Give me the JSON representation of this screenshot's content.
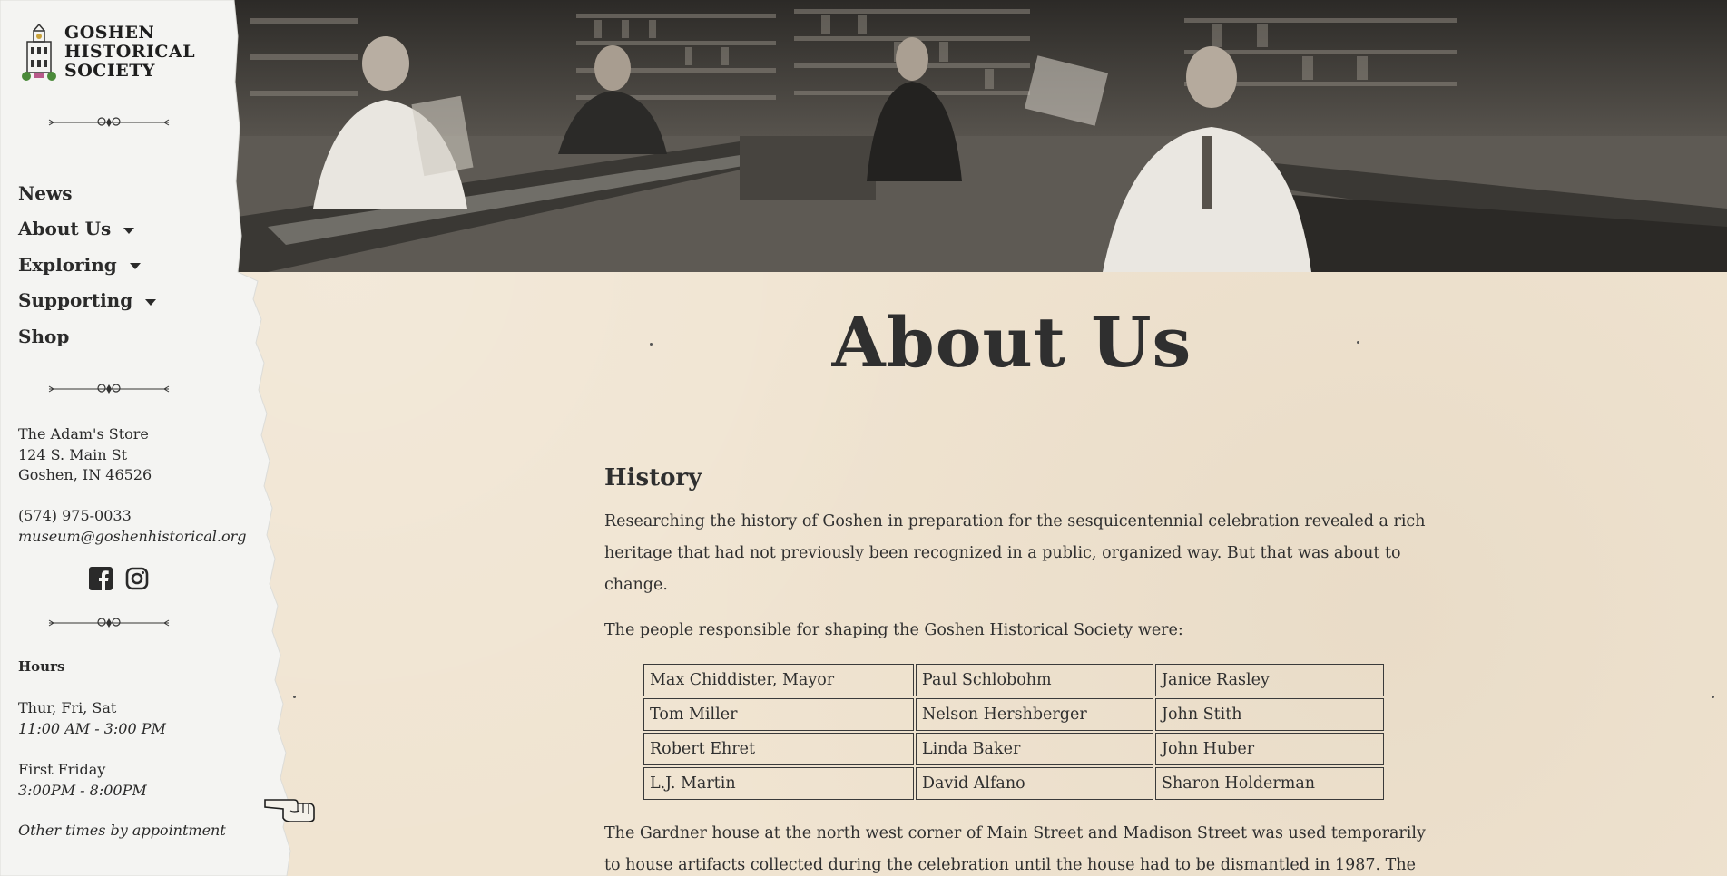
{
  "site": {
    "logo_lines": [
      "GOSHEN",
      "HISTORICAL",
      "SOCIETY"
    ]
  },
  "nav": [
    {
      "label": "News",
      "has_dropdown": false
    },
    {
      "label": "About Us",
      "has_dropdown": true
    },
    {
      "label": "Exploring",
      "has_dropdown": true
    },
    {
      "label": "Supporting",
      "has_dropdown": true
    },
    {
      "label": "Shop",
      "has_dropdown": false
    }
  ],
  "address": {
    "line1": "The Adam's Store",
    "line2": "124 S. Main St",
    "line3": "Goshen, IN 46526"
  },
  "contact": {
    "phone": "(574) 975-0033",
    "email": "museum@goshenhistorical.org"
  },
  "social": [
    "facebook-icon",
    "instagram-icon"
  ],
  "hours": {
    "heading": "Hours",
    "days1": "Thur, Fri, Sat",
    "time1": "11:00 AM - 3:00 PM",
    "days2": "First Friday",
    "time2": "3:00PM - 8:00PM",
    "note": "Other times by appointment"
  },
  "page": {
    "title": "About Us",
    "section_heading": "History",
    "para1": "Researching the history of Goshen in preparation for the sesquicentennial celebration revealed a rich heritage that had not previously been recognized in a public, organized way. But that was about to change.",
    "para2": "The people responsible for shaping the Goshen Historical Society were:",
    "founders": [
      [
        "Max Chiddister, Mayor",
        "Paul Schlobohm",
        "Janice Rasley"
      ],
      [
        "Tom Miller",
        "Nelson Hershberger",
        "John Stith"
      ],
      [
        "Robert Ehret",
        "Linda Baker",
        "John Huber"
      ],
      [
        "L.J. Martin",
        "David Alfano",
        "Sharon Holderman"
      ]
    ],
    "para3": "The Gardner house at the north west corner of Main Street and Madison Street was used temporarily to house artifacts collected during the celebration until the house had to be dismantled in 1987. The artifacts were then stored in the city's Annex Building, out of sight."
  }
}
